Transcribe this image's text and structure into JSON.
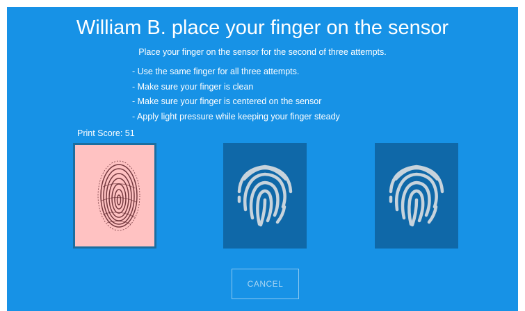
{
  "header": {
    "title": "William B. place your finger on the sensor",
    "subtitle": "Place your finger on the sensor for the second of three attempts."
  },
  "instructions": [
    "- Use the same finger for all three attempts.",
    "- Make sure your finger is clean",
    "- Make sure your finger is centered on the sensor",
    "- Apply light pressure while keeping your finger steady"
  ],
  "print_score": {
    "label": "Print Score: 51",
    "value": 51
  },
  "attempts": [
    {
      "status": "captured",
      "icon": "fingerprint-scan-image"
    },
    {
      "status": "pending",
      "icon": "fingerprint-icon"
    },
    {
      "status": "pending",
      "icon": "fingerprint-icon"
    }
  ],
  "actions": {
    "cancel_label": "CANCEL"
  },
  "colors": {
    "background": "#1792e6",
    "tile_pending": "#0f68a8",
    "tile_captured": "#ffc2c2",
    "fingerprint_icon": "#c7d3dc",
    "fingerprint_scan": "#5a1f26"
  }
}
